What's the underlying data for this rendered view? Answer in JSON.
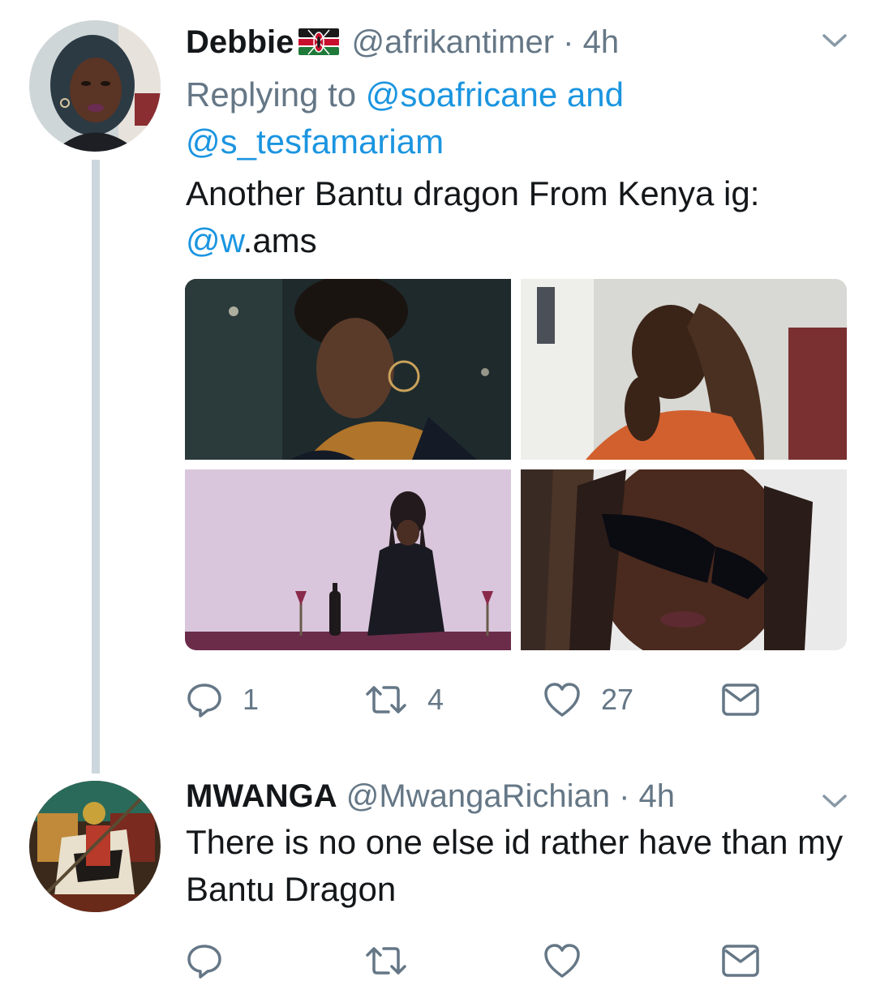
{
  "tweets": [
    {
      "author_name": "Debbie",
      "author_flag_icon": "kenya-flag-icon",
      "handle": "@afrikantimer",
      "separator": "·",
      "time": "4h",
      "replying_prefix": "Replying to",
      "replying_to": "@soafricane and @s_tesfamariam",
      "text_line1": "Another Bantu dragon From Kenya ig:",
      "text_mention": "@w",
      "text_tail": ".ams",
      "media": [
        "photo",
        "photo",
        "photo",
        "photo"
      ],
      "actions": {
        "reply_count": "1",
        "retweet_count": "4",
        "like_count": "27"
      }
    },
    {
      "author_name": "MWANGA",
      "handle": "@MwangaRichian",
      "separator": "·",
      "time": "4h",
      "text": "There is no one else id rather have than my Bantu Dragon",
      "actions": {
        "reply_count": "",
        "retweet_count": "",
        "like_count": ""
      }
    }
  ],
  "colors": {
    "text": "#14171a",
    "secondary": "#657786",
    "link": "#1b95e0",
    "thread_line": "#ccd6dd"
  },
  "icons": [
    "reply-icon",
    "retweet-icon",
    "like-icon",
    "direct-message-icon",
    "chevron-down-icon"
  ]
}
